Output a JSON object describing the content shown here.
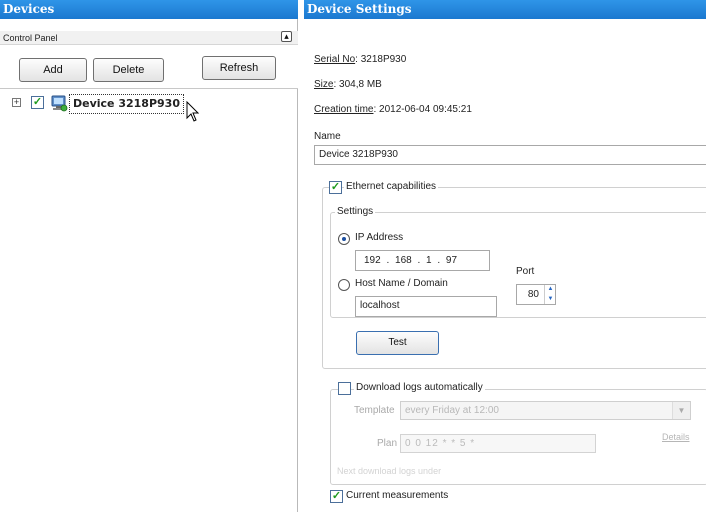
{
  "left_pane": {
    "title": "Devices",
    "control_panel_label": "Control Panel",
    "collapse_glyph": "▴",
    "toolbar": {
      "add_label": "Add",
      "delete_label": "Delete",
      "refresh_label": "Refresh"
    },
    "tree": {
      "expander_glyph": "+",
      "checkbox_glyph": "✓",
      "device_label": "Device 3218P930",
      "device_icon": "device-computer-icon"
    }
  },
  "right_pane": {
    "title": "Device Settings",
    "serial_key": "Serial No",
    "serial_value": ": 3218P930",
    "size_key": "Size",
    "size_value": ": 304,8 MB",
    "creation_key": "Creation time",
    "creation_value": ": 2012-06-04 09:45:21",
    "name_label": "Name",
    "name_value": "Device 3218P930",
    "ethernet": {
      "label": "Ethernet capabilities",
      "checked_glyph": "✓",
      "settings_label": "Settings",
      "ip_radio_label": "IP Address",
      "ip_value": "192 . 168 . 1 . 97",
      "host_radio_label": "Host Name / Domain",
      "host_value": "localhost",
      "port_label": "Port",
      "port_value": "80",
      "spin_up": "▲",
      "spin_down": "▼",
      "test_label": "Test"
    },
    "download": {
      "label": "Download logs automatically",
      "template_label": "Template",
      "template_value": "every Friday at 12:00",
      "dropdown_glyph": "▼",
      "plan_label": "Plan",
      "plan_value": "0 0 12 * * 5 *",
      "details_label": "Details",
      "hint": "Next download logs under"
    },
    "current_measurements_label": "Current measurements",
    "current_checked_glyph": "✓"
  },
  "colors": {
    "header_bg": "#1f82d8",
    "checkbox_check": "#1e9a1e",
    "radio_dot": "#1c4fa0"
  }
}
